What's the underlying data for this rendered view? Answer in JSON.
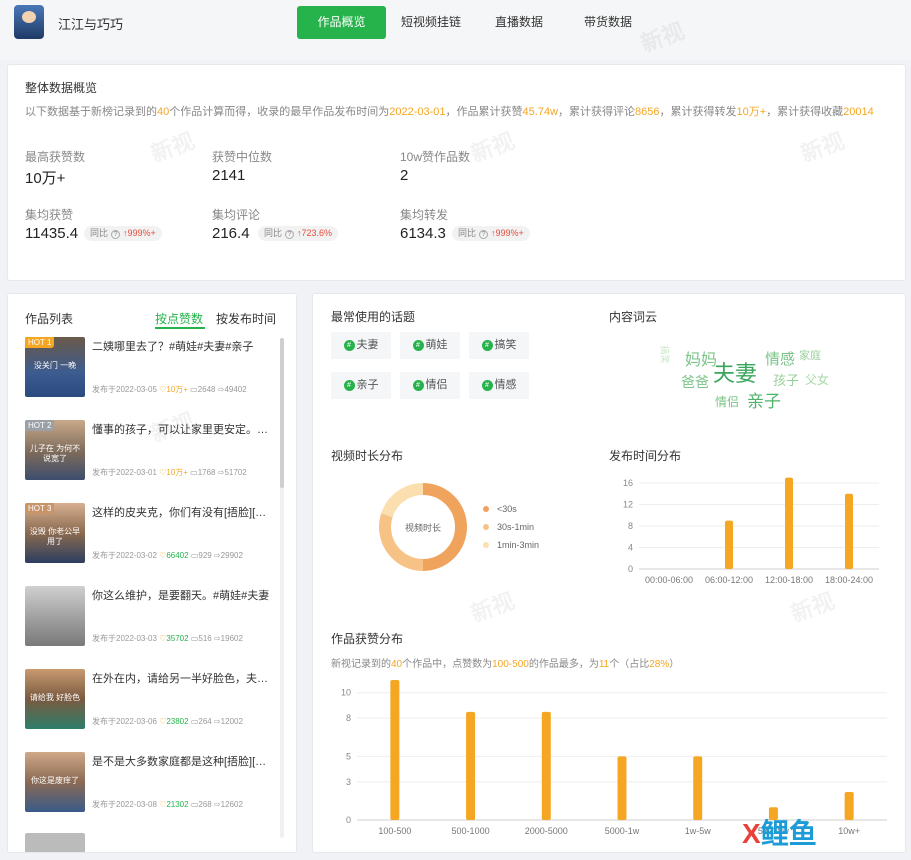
{
  "header": {
    "account_name": "江江与巧巧",
    "tabs": [
      "作品概览",
      "短视频挂链",
      "直播数据",
      "带货数据"
    ]
  },
  "overview": {
    "title": "整体数据概览",
    "summary": {
      "p1": "以下数据基于新榜记录到的",
      "works": "40",
      "p2": "个作品计算而得，收录的最早作品发布时间为",
      "earliest": "2022-03-01",
      "p3": "，作品累计获赞",
      "likes": "45.74w",
      "p4": "，累计获得评论",
      "comments": "8656",
      "p5": "，累计获得转发",
      "shares": "10万+",
      "p6": "，累计获得收藏",
      "favorites": "20014"
    },
    "metrics": [
      {
        "label": "最高获赞数",
        "value": "10万+"
      },
      {
        "label": "获赞中位数",
        "value": "2141"
      },
      {
        "label": "10w赞作品数",
        "value": "2"
      },
      {
        "label": "集均获赞",
        "value": "11435.4",
        "cmp_label": "同比",
        "cmp_value": "999%+"
      },
      {
        "label": "集均评论",
        "value": "216.4",
        "cmp_label": "同比",
        "cmp_value": "723.6%"
      },
      {
        "label": "集均转发",
        "value": "6134.3",
        "cmp_label": "同比",
        "cmp_value": "999%+"
      }
    ]
  },
  "works_list": {
    "title": "作品列表",
    "sort_tabs": [
      "按点赞数",
      "按发布时间"
    ],
    "items": [
      {
        "badge": "HOT 1",
        "caption": "没关门 一晚",
        "title": "二姨哪里去了？#萌娃#夫妻#亲子",
        "date": "发布于2022-03-05",
        "likes": "10万+",
        "comments": "2648",
        "shares": "49402"
      },
      {
        "badge": "HOT 2",
        "caption": "儿子在 为何不说宽了",
        "title": "懂事的孩子，可以让家里更安定。#...",
        "date": "发布于2022-03-01",
        "likes": "10万+",
        "comments": "1768",
        "shares": "51702"
      },
      {
        "badge": "HOT 3",
        "caption": "没毁 你老公早用了",
        "title": "这样的皮夹克，你们有没有[捂脸][捂...",
        "date": "发布于2022-03-02",
        "likes": "66402",
        "comments": "929",
        "shares": "29902"
      },
      {
        "badge": "",
        "caption": "",
        "title": "你这么维护，是要翻天。#萌娃#夫妻",
        "date": "发布于2022-03-03",
        "likes": "35702",
        "comments": "516",
        "shares": "19602"
      },
      {
        "badge": "",
        "caption": "请给我 好脸色",
        "title": "在外在内，请给另一半好脸色，夫妻...",
        "date": "发布于2022-03-06",
        "likes": "23802",
        "comments": "264",
        "shares": "12002"
      },
      {
        "badge": "",
        "caption": "你这是废痒了",
        "title": "是不是大多数家庭都是这种[捂脸][捂...",
        "date": "发布于2022-03-08",
        "likes": "21302",
        "comments": "268",
        "shares": "12602"
      }
    ]
  },
  "topics": {
    "title": "最常使用的话题",
    "items": [
      "夫妻",
      "萌娃",
      "搞笑",
      "亲子",
      "情侣",
      "情感"
    ]
  },
  "word_cloud": {
    "title": "内容词云",
    "words": [
      "夫妻",
      "妈妈",
      "情感",
      "家庭",
      "爸爸",
      "孩子",
      "父女",
      "情侣",
      "亲子",
      "搞笑"
    ]
  },
  "duration_chart": {
    "title": "视频时长分布",
    "center_label": "视频时长",
    "legend": [
      "<30s",
      "30s-1min",
      "1min-3min"
    ],
    "colors": [
      "#f0a35c",
      "#f7c285",
      "#fbdfae"
    ]
  },
  "chart_data": [
    {
      "type": "pie",
      "title": "视频时长分布",
      "categories": [
        "<30s",
        "30s-1min",
        "1min-3min"
      ],
      "values": [
        50,
        30,
        20
      ]
    },
    {
      "type": "bar",
      "title": "发布时间分布",
      "categories": [
        "00:00-06:00",
        "06:00-12:00",
        "12:00-18:00",
        "18:00-24:00"
      ],
      "values": [
        0,
        9,
        17,
        14
      ],
      "ylim": [
        0,
        16
      ],
      "yticks": [
        "0",
        "4",
        "8",
        "12",
        "16"
      ],
      "color": "#f5a623"
    },
    {
      "type": "bar",
      "title": "作品获赞分布",
      "subtitle": {
        "p1": "新视记录到的",
        "works": "40",
        "p2": "个作品中，点赞数为",
        "range": "100-500",
        "p3": "的作品最多，为",
        "count": "11",
        "p4": "个（占比",
        "pct": "28%",
        "p5": "）"
      },
      "categories": [
        "100-500",
        "500-1000",
        "2000-5000",
        "5000-1w",
        "1w-5w",
        "5w-10w",
        "10w+"
      ],
      "values": [
        11,
        8.5,
        8.5,
        5,
        5,
        1,
        2.2
      ],
      "ylim": [
        0,
        11
      ],
      "yticks": [
        "0",
        "3",
        "5",
        "8",
        "10"
      ],
      "color": "#f5a623"
    }
  ],
  "watermark": "新视"
}
